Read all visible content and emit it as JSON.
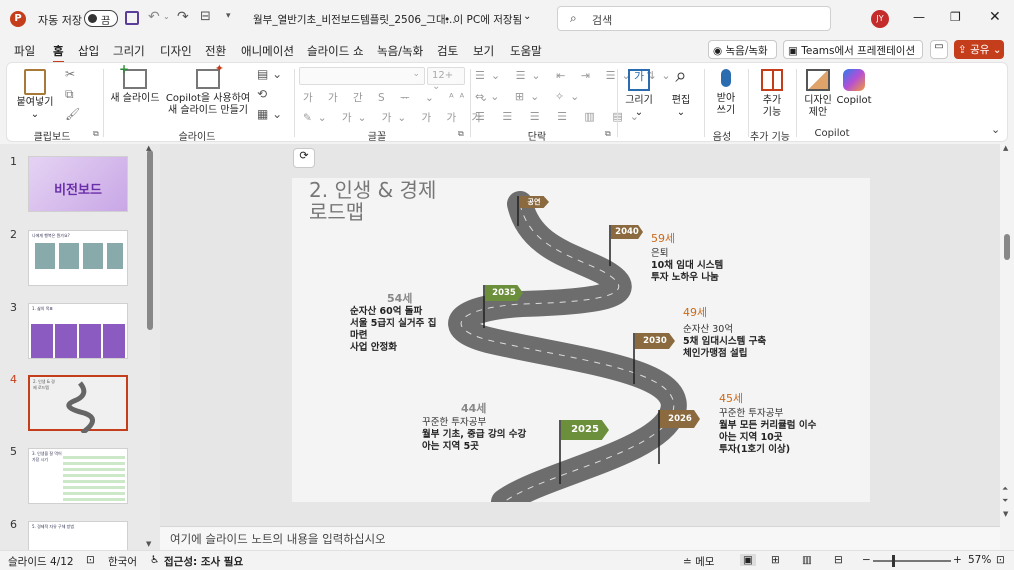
{
  "titlebar": {
    "autosave_label": "자동 저장",
    "autosave_state": "끔",
    "filename": "월부_열반기초_비전보드템플릿_2506_그대...",
    "save_location": "• 이 PC에 저장됨",
    "search_placeholder": "검색",
    "user_initials": "JY"
  },
  "menu": {
    "tabs": [
      "파일",
      "홈",
      "삽입",
      "그리기",
      "디자인",
      "전환",
      "애니메이션",
      "슬라이드 쇼",
      "녹음/녹화",
      "검토",
      "보기",
      "도움말"
    ],
    "record_label": "녹음/녹화",
    "teams_label": "Teams에서 프레젠테이션",
    "share_label": "공유"
  },
  "ribbon": {
    "paste": "붙여넣기",
    "clipboard": "클립보드",
    "new_slide": "새 슬라이드",
    "copilot_new": "Copilot을 사용하여\n새 슬라이드 만들기",
    "slides_group": "슬라이드",
    "font_group": "글꼴",
    "font_size": "12+",
    "para_group": "단락",
    "draw": "그리기",
    "edit": "편집",
    "dictate": "받아\n쓰기",
    "voice_group": "음성",
    "addins": "추가\n기능",
    "addins_group": "추가 기능",
    "designer": "디자인\n제안",
    "copilot": "Copilot",
    "copilot_group": "Copilot"
  },
  "thumbs": [
    {
      "num": "1",
      "caption": "비전보드"
    },
    {
      "num": "2",
      "caption": "나에게 행복은 뭔가요?"
    },
    {
      "num": "3",
      "caption": "1. 삶의 목표"
    },
    {
      "num": "4",
      "caption": "2. 인생 & 경제 로드맵"
    },
    {
      "num": "5",
      "caption": "3. 인생을 잘 먹어 가장 시기"
    },
    {
      "num": "6",
      "caption": "5. 경제적 자유 구체 방법"
    }
  ],
  "slide": {
    "title_line1": "2. 인생 & 경제",
    "title_line2": "로드맵",
    "flag_start": "공연",
    "flag_2040": "2040",
    "flag_2035": "2035",
    "flag_2030": "2030",
    "flag_2026": "2026",
    "flag_2025": "2025",
    "age59": "59세",
    "age59_lines": [
      "은퇴",
      "10채 임대 시스템",
      "투자 노하우 나눔"
    ],
    "age54": "54세",
    "age54_lines": [
      "순자산 60억 돌파",
      "서울 5급지 실거주 집",
      "마련",
      "사업 안정화"
    ],
    "age49": "49세",
    "age49_lines": [
      "순자산 30억",
      "5채 임대시스템 구축",
      "체인가맹점 설립"
    ],
    "age44": "44세",
    "age44_lines": [
      "꾸준한 투자공부",
      "월부 기초, 중급 강의 수강",
      "아는 지역 5곳"
    ],
    "age45": "45세",
    "age45_lines": [
      "꾸준한 투자공부",
      "월부 모든 커리큘럼 이수",
      "아는 지역 10곳",
      "투자(1호기 이상)"
    ]
  },
  "notes_placeholder": "여기에 슬라이드 노트의 내용을 입력하십시오",
  "status": {
    "slide_pos": "슬라이드 4/12",
    "language": "한국어",
    "accessibility": "접근성: 조사 필요",
    "notes": "메모",
    "zoom": "57%"
  },
  "colors": {
    "accent": "#c43e1c",
    "road": "#6b6b6b",
    "flag_brown": "#8a6a3e",
    "flag_green": "#6b8f3a",
    "age_orange": "#c96a1a"
  }
}
